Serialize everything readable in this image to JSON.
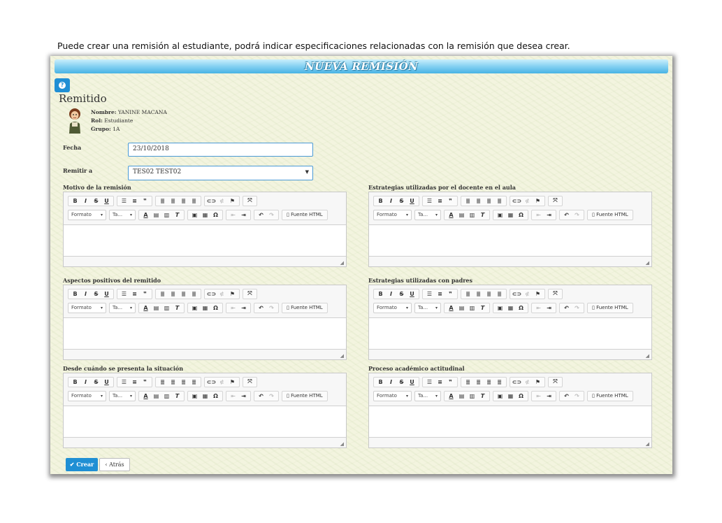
{
  "caption": "Puede crear una remisión al estudiante, podrá indicar especificaciones relacionadas con la remisión que desea crear.",
  "header": {
    "title": "NUEVA REMISIÓN"
  },
  "help_icon": "question-icon",
  "remitido": {
    "section_title": "Remitido",
    "nombre_label": "Nombre:",
    "nombre": "YANINE MACANA",
    "rol_label": "Rol:",
    "rol": "Estudiante",
    "grupo_label": "Grupo:",
    "grupo": "1A"
  },
  "form": {
    "fecha_label": "Fecha",
    "fecha_value": "23/10/2018",
    "remitir_label": "Remitir a",
    "remitir_value": "TES02 TEST02"
  },
  "editor_toolbar": {
    "bold": "B",
    "italic": "I",
    "strike": "S",
    "underline": "U",
    "format": "Formato",
    "size": "Ta...",
    "source": "Fuente HTML"
  },
  "editors": [
    {
      "label": "Motivo de la remisión"
    },
    {
      "label": "Estrategias utilizadas por el docente en el aula"
    },
    {
      "label": "Aspectos positivos del remitido"
    },
    {
      "label": "Estrategias utilizadas con padres"
    },
    {
      "label": "Desde cuándo se presenta la situación"
    },
    {
      "label": "Proceso académico actitudinal"
    }
  ],
  "actions": {
    "create": "Crear",
    "back": "Atrás"
  },
  "colors": {
    "accent": "#1f8fd4",
    "header_gradient_bottom": "#48b3e4",
    "background": "#f3f4df"
  }
}
